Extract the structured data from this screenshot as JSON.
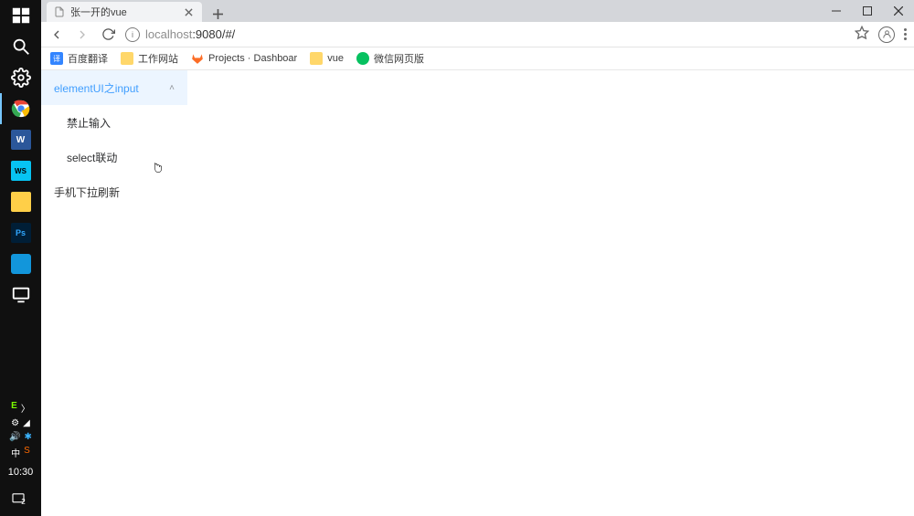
{
  "taskbar": {
    "clock": "10:30",
    "notification_count": "2",
    "ime": "中",
    "apps": [
      {
        "name": "windows-start",
        "color": "#ffffff"
      },
      {
        "name": "search",
        "color": "#ffffff"
      },
      {
        "name": "settings",
        "color": "#ffffff"
      },
      {
        "name": "chrome",
        "active": true
      },
      {
        "name": "word",
        "bg": "#2b579a",
        "label": "W"
      },
      {
        "name": "webstorm",
        "bg": "#07c3f2",
        "label": "WS"
      },
      {
        "name": "file-explorer",
        "bg": "#ffcf48"
      },
      {
        "name": "photoshop",
        "bg": "#001e36",
        "label": "Ps",
        "fg": "#31a8ff"
      },
      {
        "name": "mobile-app",
        "bg": "#1296db"
      },
      {
        "name": "monitor-app",
        "bg": "#333333"
      }
    ]
  },
  "browser": {
    "tab": {
      "title": "张一开的vue"
    },
    "address": {
      "host": "localhost",
      "port_path": ":9080/#/"
    },
    "bookmarks": [
      {
        "label": "百度翻译",
        "icon_bg": "#3385ff",
        "icon_text": "译"
      },
      {
        "label": "工作网站",
        "icon_bg": "#ffd76a",
        "type": "folder"
      },
      {
        "label": "Projects · Dashboar",
        "icon_bg": "#fc6d26",
        "type": "gitlab"
      },
      {
        "label": "vue",
        "icon_bg": "#ffd76a",
        "type": "folder"
      },
      {
        "label": "微信网页版",
        "icon_bg": "#07c160",
        "type": "wechat"
      }
    ]
  },
  "menu": {
    "items": [
      {
        "label": "elementUI之input",
        "expanded": true,
        "children": [
          {
            "label": "禁止输入"
          },
          {
            "label": "select联动"
          }
        ]
      },
      {
        "label": "手机下拉刷新"
      }
    ]
  }
}
